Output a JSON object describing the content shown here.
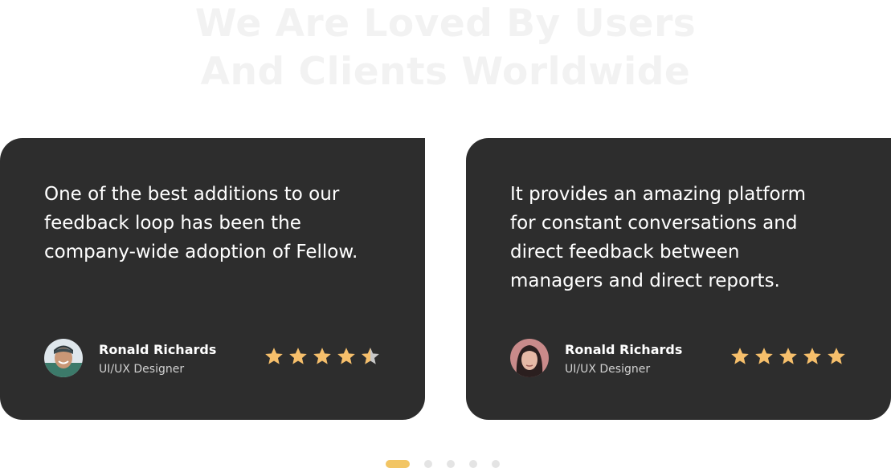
{
  "section": {
    "heading_line1": "We Are Loved By Users",
    "heading_line2": "And Clients Worldwide"
  },
  "colors": {
    "card_bg": "#2d2d2d",
    "star": "#f6bf6b",
    "star_empty": "#c8c8c8",
    "dot_active": "#f2c564",
    "dot_inactive": "#e4e4e4"
  },
  "testimonials": [
    {
      "quote": "One of the best additions to our feedback loop has been the company-wide adoption of Fellow.",
      "name": "Ronald Richards",
      "role": "UI/UX Designer",
      "rating": 4.5
    },
    {
      "quote": "It provides an amazing platform for constant conversations and direct feedback between managers and direct reports.",
      "name": "Ronald Richards",
      "role": "UI/UX Designer",
      "rating": 5
    }
  ],
  "pagination": {
    "total": 5,
    "active": 1
  }
}
